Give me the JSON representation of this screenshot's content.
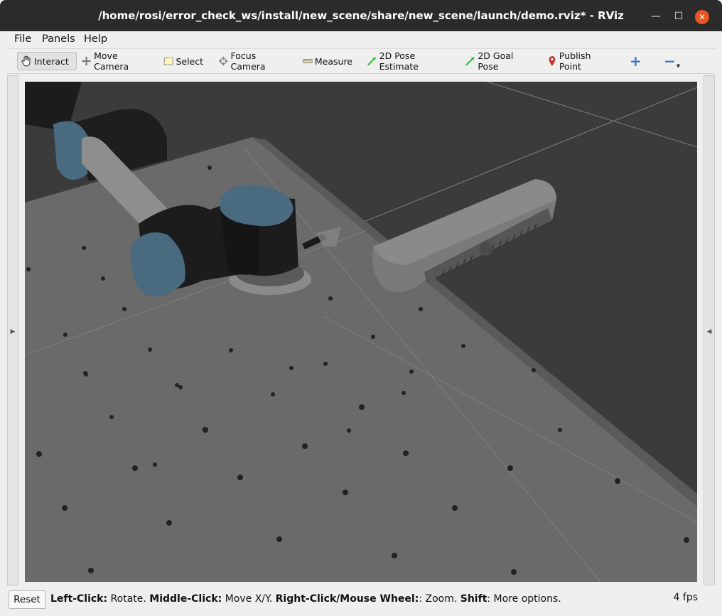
{
  "window": {
    "title": "/home/rosi/error_check_ws/install/new_scene/share/new_scene/launch/demo.rviz* - RViz",
    "minimize_glyph": "—",
    "maximize_glyph": "☐",
    "close_glyph": "✕"
  },
  "menu": {
    "file": "File",
    "panels": "Panels",
    "help": "Help"
  },
  "toolbar": {
    "interact": "Interact",
    "move_camera": "Move Camera",
    "select": "Select",
    "focus_camera": "Focus Camera",
    "measure": "Measure",
    "pose_estimate": "2D Pose Estimate",
    "goal_pose": "2D Goal Pose",
    "publish_point": "Publish Point",
    "add_glyph": "+",
    "remove_glyph": "−",
    "add_icon": "plus-icon",
    "remove_icon": "minus-icon"
  },
  "status": {
    "reset": "Reset",
    "left_click_key": "Left-Click:",
    "left_click_desc": " Rotate. ",
    "middle_click_key": "Middle-Click:",
    "middle_click_desc": " Move X/Y. ",
    "right_click_key": "Right-Click/Mouse Wheel:",
    "right_click_desc": ": Zoom. ",
    "shift_key": "Shift",
    "shift_desc": ": More options.",
    "fps": "4 fps"
  },
  "colors": {
    "title_bg": "#2b2b2b",
    "close_button": "#e95420",
    "viewport_bg": "#3b3b3b",
    "table": "#6b6b6b",
    "robot_link": "#1c1c1c",
    "robot_cap": "#4a6a80"
  }
}
